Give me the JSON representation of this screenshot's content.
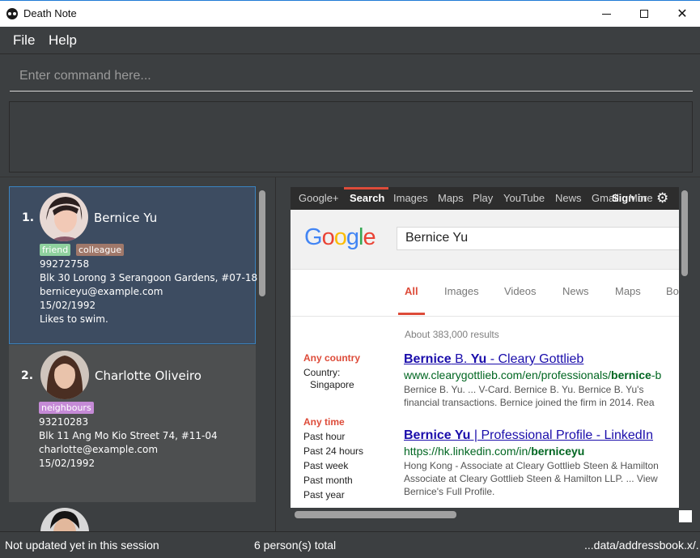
{
  "window": {
    "title": "Death Note"
  },
  "menu": {
    "file": "File",
    "help": "Help"
  },
  "command": {
    "placeholder": "Enter command here..."
  },
  "persons": [
    {
      "index": "1.",
      "name": "Bernice Yu",
      "tags": [
        {
          "label": "friend",
          "color": "#8fd19e"
        },
        {
          "label": "colleague",
          "color": "#a0786a"
        }
      ],
      "phone": "99272758",
      "address": "Blk 30 Lorong 3 Serangoon Gardens, #07-18",
      "email": "berniceyu@example.com",
      "date": "15/02/1992",
      "note": "Likes to swim."
    },
    {
      "index": "2.",
      "name": "Charlotte Oliveiro",
      "tags": [
        {
          "label": "neighbours",
          "color": "#c58ad6"
        }
      ],
      "phone": "93210283",
      "address": "Blk 11 Ang Mo Kio Street 74, #11-04",
      "email": "charlotte@example.com",
      "date": "15/02/1992"
    }
  ],
  "browser": {
    "topbar": [
      "Google+",
      "Search",
      "Images",
      "Maps",
      "Play",
      "YouTube",
      "News",
      "Gmail",
      "Sign in",
      "More"
    ],
    "logo": "Google",
    "query": "Bernice Yu",
    "tabs": [
      "All",
      "Images",
      "Videos",
      "News",
      "Maps",
      "Bo"
    ],
    "stats": "About 383,000 results",
    "filters": {
      "country_head": "Any country",
      "country_label": "Country:",
      "country_value": "Singapore",
      "time_head": "Any time",
      "times": [
        "Past hour",
        "Past 24 hours",
        "Past week",
        "Past month",
        "Past year"
      ]
    },
    "results": [
      {
        "title_bold": "Bernice",
        "title_mid": " B. ",
        "title_bold2": "Yu",
        "title_rest": " - Cleary Gottlieb",
        "url": "www.clearygottlieb.com/en/professionals/",
        "url_bold": "bernice",
        "url_rest": "-b",
        "snip1": "Bernice B. Yu. ... V-Card. Bernice B. Yu. Bernice B. Yu's",
        "snip2": "financial transactions. Bernice joined the firm in 2014. Rea"
      },
      {
        "title_bold": "Bernice Yu",
        "title_rest": " | Professional Profile - LinkedIn",
        "url": "https://hk.linkedin.com/in/",
        "url_bold": "berniceyu",
        "snip1": "Hong Kong - Associate at Cleary Gottlieb Steen & Hamilton",
        "snip2": "Associate at Cleary Gottlieb Steen & Hamilton LLP. ... View",
        "snip3": "Bernice's Full Profile."
      }
    ]
  },
  "status": {
    "sync": "Not updated yet in this session",
    "total": "6 person(s) total",
    "path": "...data/addressbook.x/."
  }
}
